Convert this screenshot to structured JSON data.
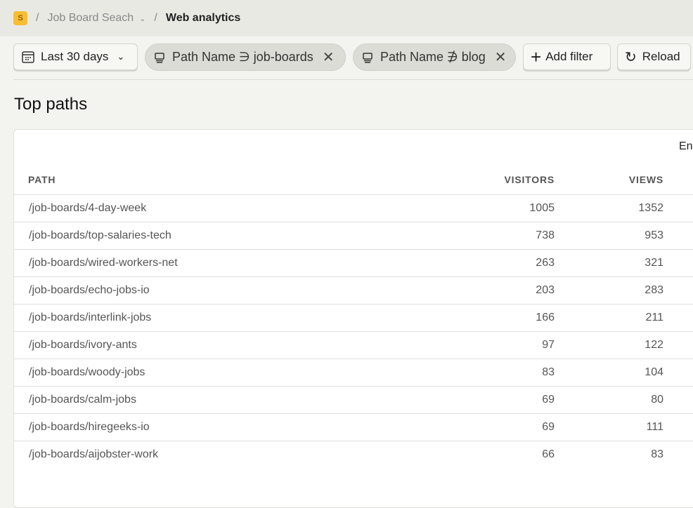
{
  "breadcrumb": {
    "logo": "S",
    "project": "Job Board Seach",
    "page": "Web analytics"
  },
  "toolbar": {
    "date_range": "Last 30 days",
    "filters": [
      "Path Name ∋ job-boards",
      "Path Name ∌ blog"
    ],
    "add_filter": "Add filter",
    "reload": "Reload"
  },
  "section": {
    "title": "Top paths",
    "partial_header": "En"
  },
  "table": {
    "columns": [
      "PATH",
      "VISITORS",
      "VIEWS"
    ],
    "rows": [
      {
        "path": "/job-boards/4-day-week",
        "visitors": "1005",
        "views": "1352"
      },
      {
        "path": "/job-boards/top-salaries-tech",
        "visitors": "738",
        "views": "953"
      },
      {
        "path": "/job-boards/wired-workers-net",
        "visitors": "263",
        "views": "321"
      },
      {
        "path": "/job-boards/echo-jobs-io",
        "visitors": "203",
        "views": "283"
      },
      {
        "path": "/job-boards/interlink-jobs",
        "visitors": "166",
        "views": "211"
      },
      {
        "path": "/job-boards/ivory-ants",
        "visitors": "97",
        "views": "122"
      },
      {
        "path": "/job-boards/woody-jobs",
        "visitors": "83",
        "views": "104"
      },
      {
        "path": "/job-boards/calm-jobs",
        "visitors": "69",
        "views": "80"
      },
      {
        "path": "/job-boards/hiregeeks-io",
        "visitors": "69",
        "views": "111"
      },
      {
        "path": "/job-boards/aijobster-work",
        "visitors": "66",
        "views": "83"
      }
    ]
  }
}
